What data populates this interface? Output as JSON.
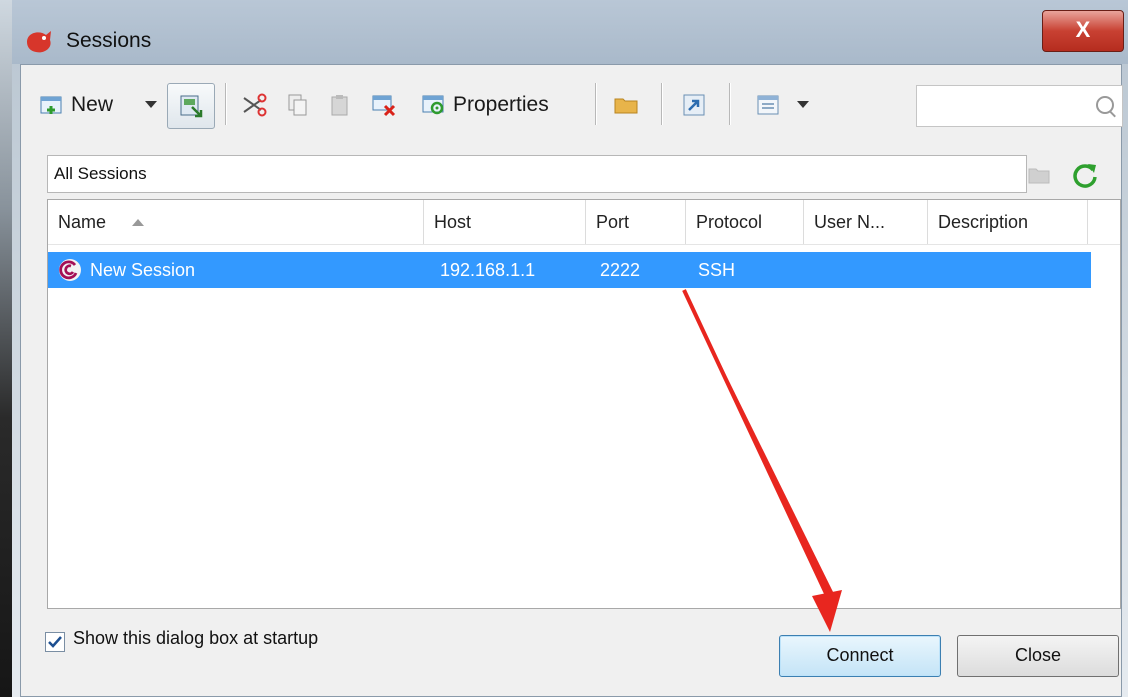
{
  "window": {
    "title": "Sessions",
    "close_label": "X"
  },
  "toolbar": {
    "new_label": "New",
    "properties_label": "Properties",
    "search_placeholder": ""
  },
  "path": {
    "label": "All Sessions"
  },
  "table": {
    "columns": [
      "Name",
      "Host",
      "Port",
      "Protocol",
      "User N...",
      "Description"
    ],
    "rows": [
      {
        "name": "New Session",
        "host": "192.168.1.1",
        "port": "2222",
        "protocol": "SSH",
        "user": "",
        "description": ""
      }
    ]
  },
  "footer": {
    "startup_label": "Show this dialog box at startup",
    "startup_checked": true
  },
  "buttons": {
    "connect": "Connect",
    "close": "Close"
  },
  "colors": {
    "selection": "#3399ff",
    "annotation_arrow": "#e8261f"
  }
}
